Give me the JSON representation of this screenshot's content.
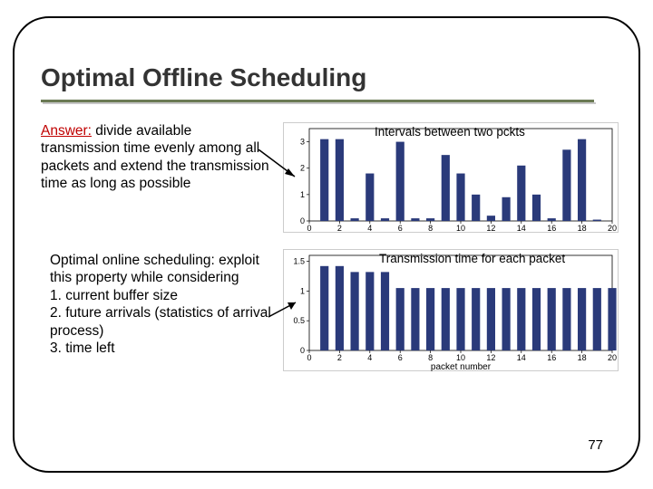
{
  "title": "Optimal Offline Scheduling",
  "para1": {
    "answer_label": "Answer:",
    "text": " divide available transmission time evenly among all packets and extend the transmission time as long as possible"
  },
  "para2": {
    "lead": "Optimal online scheduling: exploit this property while considering",
    "item1": "1. current buffer size",
    "item2": "2. future arrivals (statistics of arrival process)",
    "item3": "3. time left"
  },
  "chart_top_caption": "Intervals between two pckts",
  "chart_bottom_caption": "Transmission time for each packet",
  "xlabel_bottom": "packet number",
  "page_number": "77",
  "chart_data": [
    {
      "type": "bar",
      "title": "Intervals between two pckts",
      "xlabel": "",
      "ylabel": "",
      "x": [
        1,
        2,
        3,
        4,
        5,
        6,
        7,
        8,
        9,
        10,
        11,
        12,
        13,
        14,
        15,
        16,
        17,
        18,
        19
      ],
      "values": [
        3.1,
        3.1,
        0.1,
        1.8,
        0.1,
        3.0,
        0.1,
        0.1,
        2.5,
        1.8,
        1.0,
        0.2,
        0.9,
        2.1,
        1.0,
        0.1,
        2.7,
        3.1,
        0.05
      ],
      "xlim": [
        0,
        20
      ],
      "ylim": [
        0,
        3.5
      ],
      "yticks": [
        0,
        1,
        2,
        3
      ],
      "xticks": [
        0,
        2,
        4,
        6,
        8,
        10,
        12,
        14,
        16,
        18,
        20
      ]
    },
    {
      "type": "bar",
      "title": "Transmission time for each packet",
      "xlabel": "packet number",
      "ylabel": "",
      "x": [
        1,
        2,
        3,
        4,
        5,
        6,
        7,
        8,
        9,
        10,
        11,
        12,
        13,
        14,
        15,
        16,
        17,
        18,
        19,
        20
      ],
      "values": [
        1.42,
        1.42,
        1.32,
        1.32,
        1.32,
        1.05,
        1.05,
        1.05,
        1.05,
        1.05,
        1.05,
        1.05,
        1.05,
        1.05,
        1.05,
        1.05,
        1.05,
        1.05,
        1.05,
        1.05
      ],
      "xlim": [
        0,
        20
      ],
      "ylim": [
        0,
        1.6
      ],
      "yticks": [
        0,
        0.5,
        1,
        1.5
      ],
      "xticks": [
        0,
        2,
        4,
        6,
        8,
        10,
        12,
        14,
        16,
        18,
        20
      ]
    }
  ]
}
